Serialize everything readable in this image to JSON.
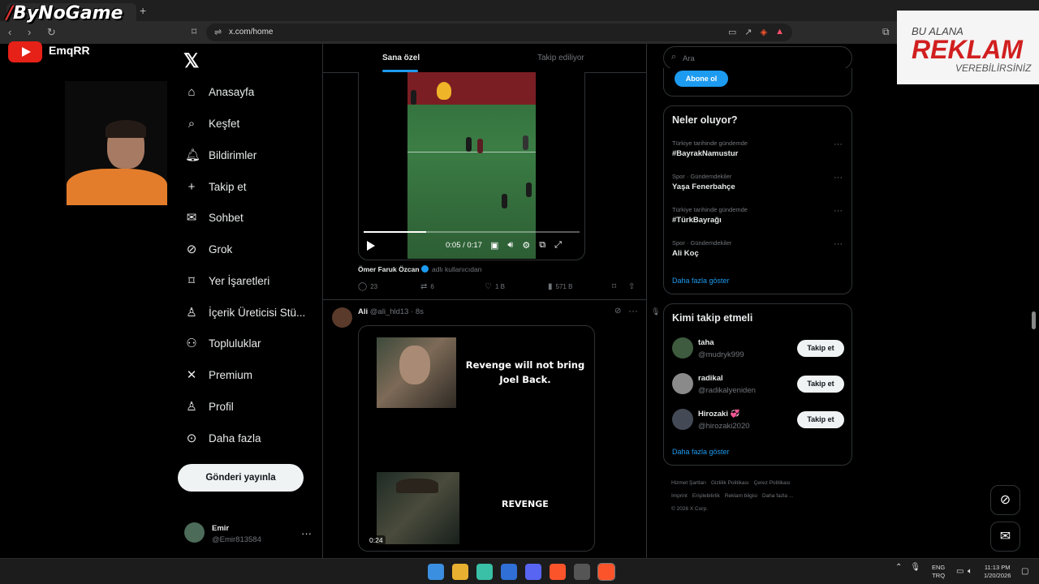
{
  "browser": {
    "url": "x.com/home",
    "nav_glyphs": "‹ › ↻"
  },
  "overlay": {
    "brand": "ByNoGame",
    "youtube_channel": "EmqRR",
    "ad_line1": "BU ALANA",
    "ad_line2": "REKLAM",
    "ad_line3": "VEREBİLİRSİNİZ"
  },
  "nav": {
    "items": [
      {
        "label": "Anasayfa",
        "icon": "home-icon",
        "glyph": "⌂"
      },
      {
        "label": "Keşfet",
        "icon": "search-icon",
        "glyph": "⌕"
      },
      {
        "label": "Bildirimler",
        "icon": "bell-icon",
        "glyph": "🔔︎"
      },
      {
        "label": "Takip et",
        "icon": "follow-icon",
        "glyph": "+"
      },
      {
        "label": "Sohbet",
        "icon": "mail-icon",
        "glyph": "✉"
      },
      {
        "label": "Grok",
        "icon": "grok-icon",
        "glyph": "⊘"
      },
      {
        "label": "Yer İşaretleri",
        "icon": "bookmark-icon",
        "glyph": "⌑"
      },
      {
        "label": "İçerik Üreticisi Stü...",
        "icon": "creator-icon",
        "glyph": "♙"
      },
      {
        "label": "Topluluklar",
        "icon": "communities-icon",
        "glyph": "⚇"
      },
      {
        "label": "Premium",
        "icon": "x-premium-icon",
        "glyph": "✕"
      },
      {
        "label": "Profil",
        "icon": "profile-icon",
        "glyph": "♙"
      },
      {
        "label": "Daha fazla",
        "icon": "more-circle-icon",
        "glyph": "⊙"
      }
    ],
    "post_button": "Gönderi yayınla",
    "account": {
      "name": "Emir",
      "handle": "@Emir813584"
    }
  },
  "feed": {
    "tabs": {
      "active": "Sana özel",
      "other": "Takip ediliyor"
    },
    "video": {
      "time": "0:05 / 0:17",
      "progress": 0.29
    },
    "attribution": {
      "name": "Ömer Faruk Özcan",
      "suffix": "adlı kullanıcıdan"
    },
    "metrics": {
      "replies": "23",
      "reposts": "6",
      "likes": "1 B",
      "views": "571 B"
    },
    "tweet2": {
      "name": "Ali",
      "handle_time": "@ali_hld13 · 8s",
      "meme_text1": "Revenge will not bring Joel Back.",
      "meme_text2": "REVENGE",
      "duration": "0:24"
    }
  },
  "right": {
    "search_placeholder": "Ara",
    "subscribe": "Abone ol",
    "trends_title": "Neler oluyor?",
    "trends": [
      {
        "context": "Türkiye tarihinde gündemde",
        "topic": "#BayrakNamustur"
      },
      {
        "context": "Spor · Gündemdekiler",
        "topic": "Yaşa Fenerbahçe"
      },
      {
        "context": "Türkiye tarihinde gündemde",
        "topic": "#TürkBayrağı"
      },
      {
        "context": "Spor · Gündemdekiler",
        "topic": "Ali Koç"
      }
    ],
    "show_more": "Daha fazla göster",
    "wtf_title": "Kimi takip etmeli",
    "users": [
      {
        "name": "taha",
        "handle": "@mudryk999",
        "color": "#3f5b3f"
      },
      {
        "name": "radikal",
        "handle": "@radikalyeniden",
        "color": "#8a8a8a"
      },
      {
        "name": "Hirozaki 💞",
        "handle": "@hirozaki2020",
        "color": "#444a55"
      }
    ],
    "follow_label": "Takip et",
    "footer": [
      "Hizmet Şartları",
      "Gizlilik Politikası",
      "Çerez Politikası",
      "Imprint",
      "Erişilebilirlik",
      "Reklam bilgisi",
      "Daha fazla ...",
      "© 2026 X Corp."
    ]
  },
  "taskbar": {
    "lang1": "ENG",
    "lang2": "TRQ",
    "time": "11:13 PM",
    "date": "1/20/2026"
  }
}
